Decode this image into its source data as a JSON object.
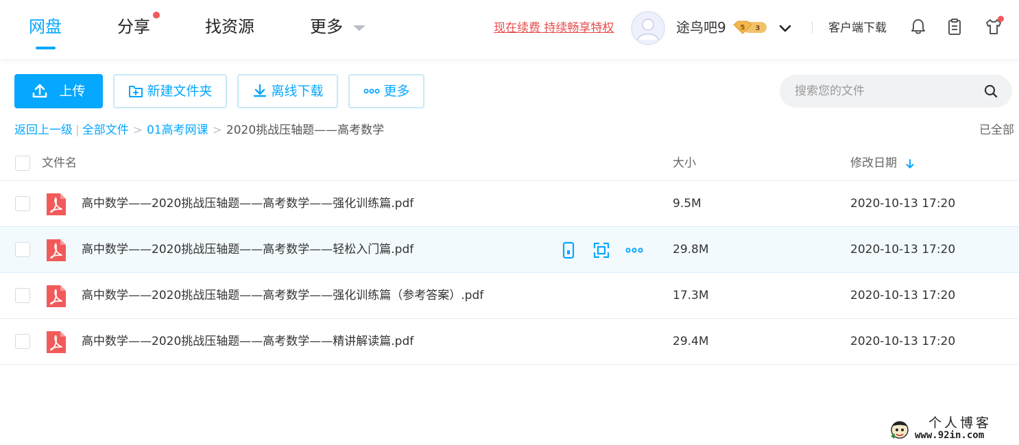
{
  "nav": {
    "items": [
      {
        "label": "网盘"
      },
      {
        "label": "分享"
      },
      {
        "label": "找资源"
      },
      {
        "label": "更多"
      }
    ],
    "renew_link": "现在续费 持续畅享特权",
    "username": "途鸟吧9",
    "vip_badge_level": "5",
    "vip_badge_count": "3",
    "client_download": "客户端下载"
  },
  "toolbar": {
    "upload": "上传",
    "new_folder": "新建文件夹",
    "offline_download": "离线下载",
    "more": "更多"
  },
  "search": {
    "placeholder": "搜索您的文件"
  },
  "breadcrumb": {
    "back": "返回上一级",
    "all_files": "全部文件",
    "folder": "01高考网课",
    "current": "2020挑战压轴题——高考数学",
    "loaded_status": "已全部"
  },
  "table": {
    "headers": {
      "name": "文件名",
      "size": "大小",
      "date": "修改日期"
    },
    "rows": [
      {
        "name": "高中数学——2020挑战压轴题——高考数学——强化训练篇.pdf",
        "size": "9.5M",
        "date": "2020-10-13 17:20"
      },
      {
        "name": "高中数学——2020挑战压轴题——高考数学——轻松入门篇.pdf",
        "size": "29.8M",
        "date": "2020-10-13 17:20"
      },
      {
        "name": "高中数学——2020挑战压轴题——高考数学——强化训练篇（参考答案）.pdf",
        "size": "17.3M",
        "date": "2020-10-13 17:20"
      },
      {
        "name": "高中数学——2020挑战压轴题——高考数学——精讲解读篇.pdf",
        "size": "29.4M",
        "date": "2020-10-13 17:20"
      }
    ]
  },
  "watermark": {
    "title": "个人博客",
    "url": "www.92in.com"
  },
  "colors": {
    "accent": "#06a7ff",
    "pdf_red": "#f25a5a",
    "renew_red": "#e94c4c",
    "row_hover": "#f3fafd"
  }
}
